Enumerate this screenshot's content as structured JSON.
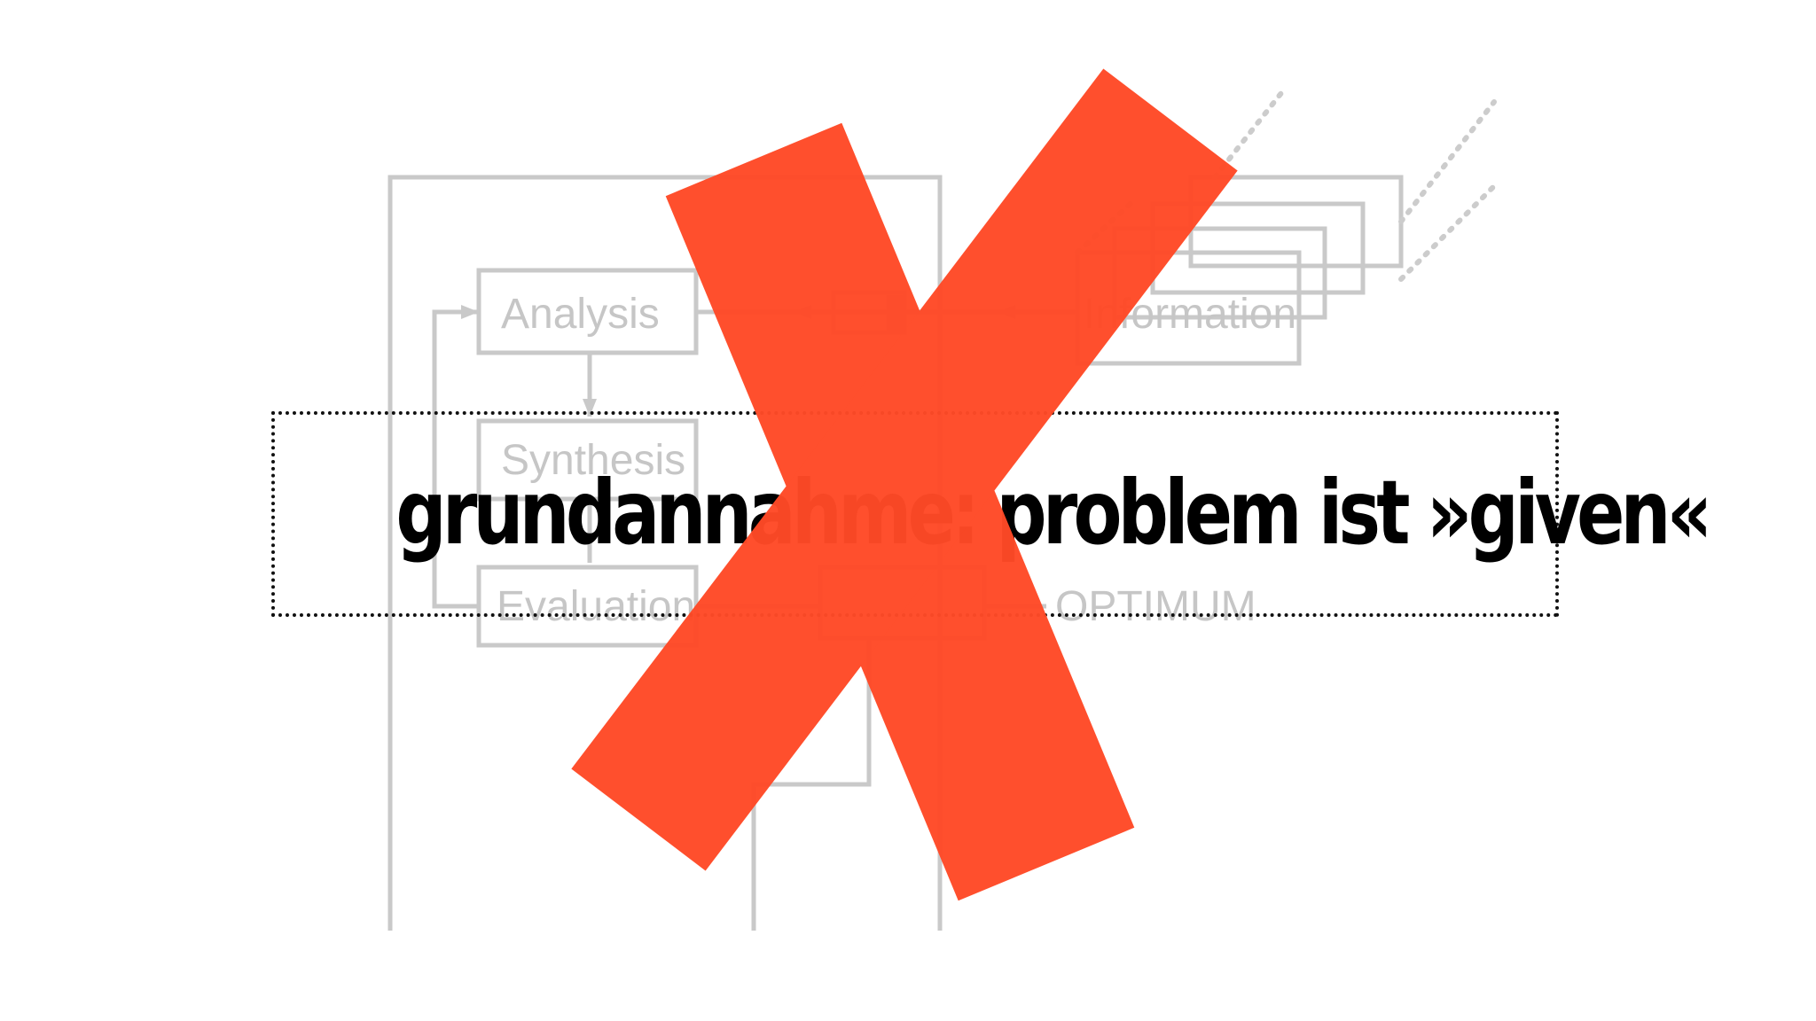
{
  "diagram": {
    "labels": {
      "analysis": "Analysis",
      "synthesis": "Synthesis",
      "evaluation": "Evaluation",
      "information": "Information",
      "optimum": "OPTIMUM"
    }
  },
  "caption": {
    "text": "grundannahme: problem ist »given«"
  },
  "cross": {
    "color": "#ff4a27",
    "opacity": 0.97
  }
}
